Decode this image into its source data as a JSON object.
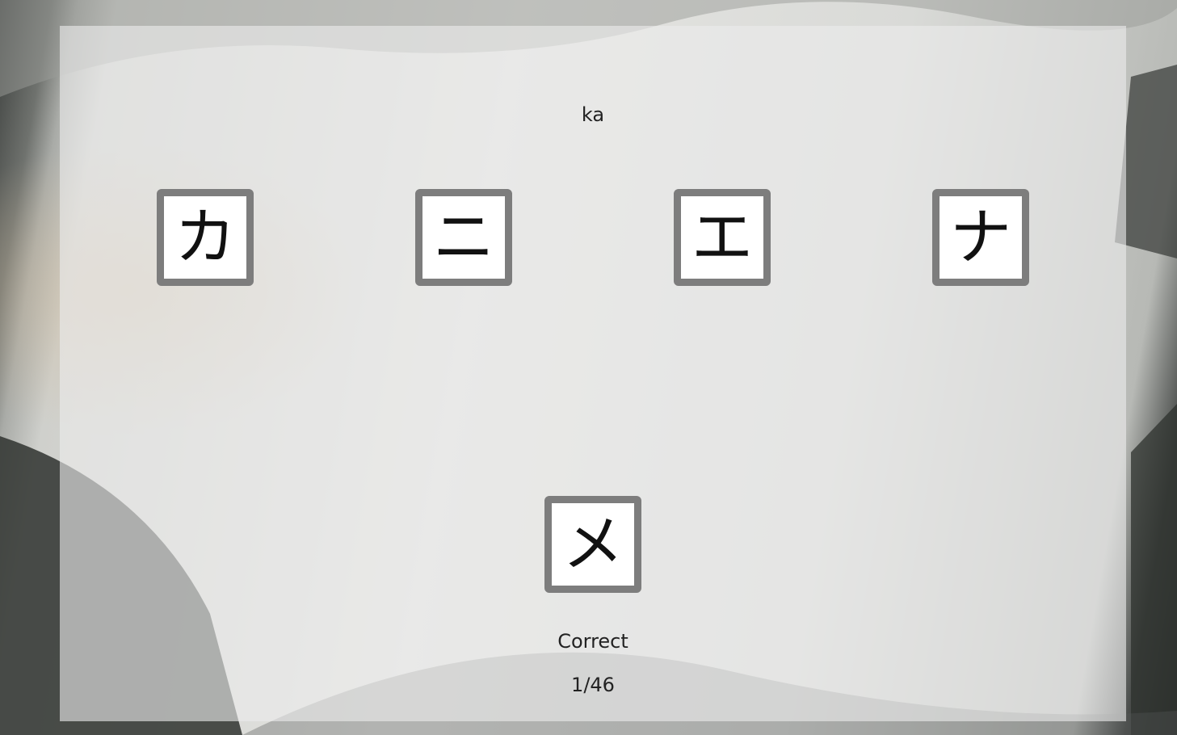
{
  "quiz": {
    "prompt": "ka",
    "choices": [
      {
        "glyph": "カ"
      },
      {
        "glyph": "ニ"
      },
      {
        "glyph": "エ"
      },
      {
        "glyph": "ナ"
      }
    ],
    "answer_glyph": "メ",
    "result": "Correct",
    "progress": "1/46"
  }
}
